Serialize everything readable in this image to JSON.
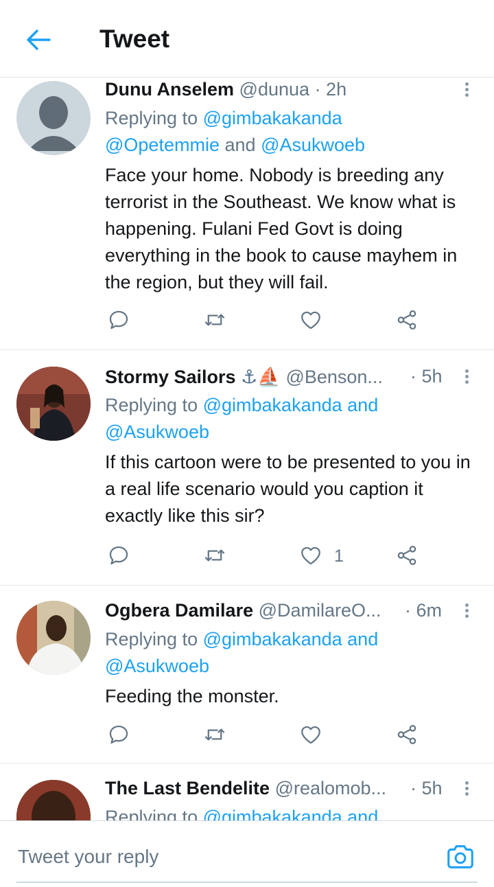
{
  "header": {
    "title": "Tweet"
  },
  "tweets": [
    {
      "name": "Dunu Anselem",
      "handle": "@dunua",
      "time": "· 2h",
      "replying_prefix": "Replying to",
      "mentions_line1": "@gimbakakanda",
      "mentions_line2_a": "@Opetemmie",
      "and": "and",
      "mentions_line2_b": "@Asukwoeb",
      "text": "Face your home. Nobody is breeding any terrorist in the Southeast. We know what is happening. Fulani Fed Govt is doing everything in the book to cause mayhem in the region, but they will fail."
    },
    {
      "name": "Stormy Sailors",
      "emoji": "⚓⛵",
      "handle": "@Benson...",
      "time": "· 5h",
      "replying_prefix": "Replying to",
      "mentions_line1": "@gimbakakanda",
      "and": "and",
      "mentions_line2": "@Asukwoeb",
      "text": "If this cartoon were to be presented to you in a real life scenario would you caption it exactly like this sir?",
      "like_count": "1"
    },
    {
      "name": "Ogbera Damilare",
      "handle": "@DamilareO...",
      "time": "· 6m",
      "replying_prefix": "Replying to",
      "mentions_line1": "@gimbakakanda",
      "and": "and",
      "mentions_line2": "@Asukwoeb",
      "text": "Feeding the monster."
    },
    {
      "name": "The Last Bendelite",
      "handle": "@realomob...",
      "time": "· 5h",
      "replying_prefix": "Replying to",
      "mentions_line1": "@gimbakakanda",
      "and": "and"
    }
  ],
  "composer": {
    "placeholder": "Tweet your reply"
  },
  "colors": {
    "accent": "#1da1f2",
    "text": "#14171a",
    "secondary": "#657786",
    "divider": "#e1e8ed"
  },
  "icons": [
    "back-arrow-icon",
    "more-icon",
    "reply-icon",
    "retweet-icon",
    "like-icon",
    "share-icon",
    "camera-icon"
  ]
}
